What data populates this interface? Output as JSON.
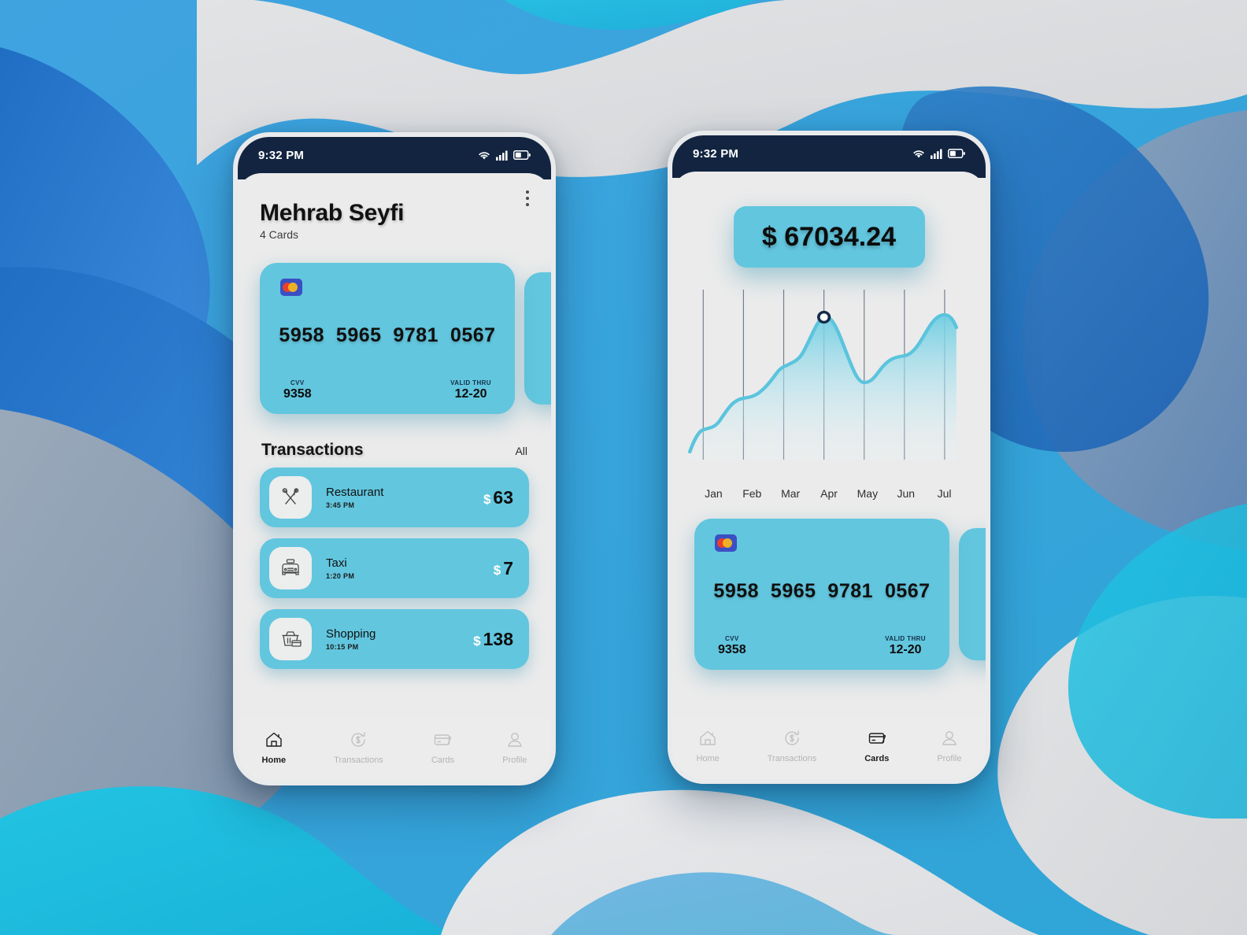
{
  "background": {
    "colors": [
      "#3d9ede",
      "#e0e1e3",
      "#1f6ec4",
      "#2aa9d8",
      "#8a9bb0",
      "#26c6e0",
      "#2f7fc6",
      "#6f8ca8",
      "#1565b8"
    ]
  },
  "theme": {
    "accent": "#62c6de",
    "status_bar_bg": "#122440",
    "screen_bg": "#ebebeb",
    "text_dark": "#111111",
    "nav_inactive": "#b4b4b4"
  },
  "status_bar": {
    "time": "9:32 PM",
    "icons": [
      "wifi-icon",
      "signal-icon",
      "battery-icon"
    ]
  },
  "phone_left": {
    "header": {
      "user_name": "Mehrab Seyfi",
      "card_count": "4 Cards",
      "menu_icon": "more-vertical-icon"
    },
    "card": {
      "brand_icon": "mastercard-icon",
      "number": "5958  5965  9781  0567",
      "cvv_label": "CVV",
      "cvv_value": "9358",
      "valid_label": "VALID THRU",
      "valid_value": "12-20"
    },
    "transactions": {
      "title": "Transactions",
      "all_label": "All",
      "items": [
        {
          "icon": "restaurant-icon",
          "name": "Restaurant",
          "time": "3:45 PM",
          "currency": "$",
          "amount": "63"
        },
        {
          "icon": "taxi-icon",
          "name": "Taxi",
          "time": "1:20 PM",
          "currency": "$",
          "amount": "7"
        },
        {
          "icon": "shopping-icon",
          "name": "Shopping",
          "time": "10:15 PM",
          "currency": "$",
          "amount": "138"
        }
      ]
    },
    "nav": {
      "items": [
        {
          "icon": "home-icon",
          "label": "Home",
          "active": true
        },
        {
          "icon": "transactions-icon",
          "label": "Transactions",
          "active": false
        },
        {
          "icon": "cards-icon",
          "label": "Cards",
          "active": false
        },
        {
          "icon": "profile-icon",
          "label": "Profile",
          "active": false
        }
      ]
    }
  },
  "phone_right": {
    "balance": "$ 67034.24",
    "card": {
      "brand_icon": "mastercard-icon",
      "number": "5958  5965  9781  0567",
      "cvv_label": "CVV",
      "cvv_value": "9358",
      "valid_label": "VALID THRU",
      "valid_value": "12-20"
    },
    "nav": {
      "items": [
        {
          "icon": "home-icon",
          "label": "Home",
          "active": false
        },
        {
          "icon": "transactions-icon",
          "label": "Transactions",
          "active": false
        },
        {
          "icon": "cards-icon",
          "label": "Cards",
          "active": true
        },
        {
          "icon": "profile-icon",
          "label": "Profile",
          "active": false
        }
      ]
    }
  },
  "chart_data": {
    "type": "area",
    "title": "",
    "xlabel": "",
    "ylabel": "",
    "categories": [
      "Jan",
      "Feb",
      "Mar",
      "Apr",
      "May",
      "Jun",
      "Jul"
    ],
    "values": [
      18,
      38,
      58,
      88,
      46,
      64,
      92
    ],
    "ylim": [
      0,
      100
    ],
    "grid": "vertical-only",
    "legend": "none",
    "line_color": "#5bc4dd",
    "fill_gradient": [
      "#6fcde2",
      "#eaf7fb"
    ],
    "marker": {
      "category": "Apr",
      "value": 88,
      "ring_color": "#152c4a",
      "fill_color": "#ffffff"
    }
  }
}
